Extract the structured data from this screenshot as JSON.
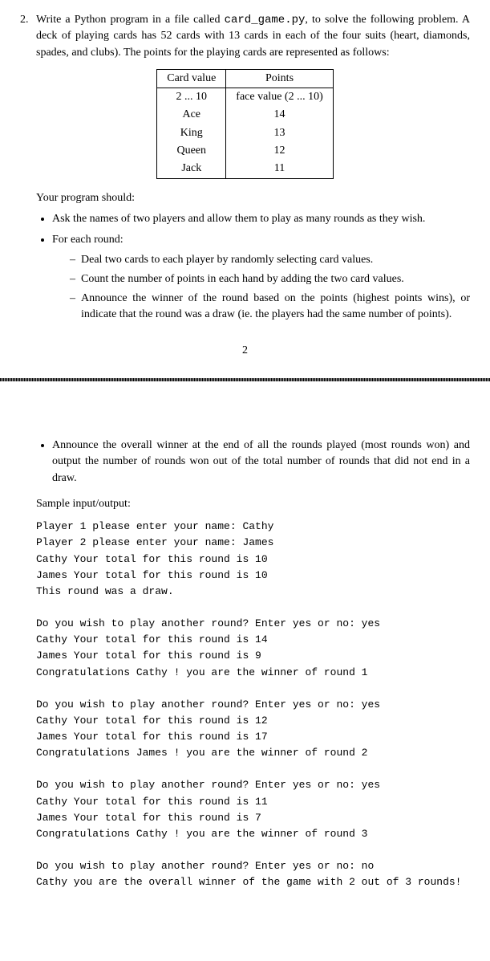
{
  "problem": {
    "number": "2.",
    "intro_pre": "Write a Python program in a file called ",
    "filename": "card_game.py",
    "intro_post": ", to solve the following problem. A deck of playing cards has 52 cards with 13 cards in each of the four suits (heart, diamonds, spades, and clubs). The points for the playing cards are represented as follows:"
  },
  "table": {
    "h1": "Card value",
    "h2": "Points",
    "rows": [
      {
        "v": "2 ... 10",
        "p": "face value (2 ... 10)"
      },
      {
        "v": "Ace",
        "p": "14"
      },
      {
        "v": "King",
        "p": "13"
      },
      {
        "v": "Queen",
        "p": "12"
      },
      {
        "v": "Jack",
        "p": "11"
      }
    ]
  },
  "req_intro": "Your program should:",
  "bullets": {
    "b1": "Ask the names of two players and allow them to play as many rounds as they wish.",
    "b2": "For each round:",
    "d1": "Deal two cards to each player by randomly selecting card values.",
    "d2": "Count the number of points in each hand by adding the two card values.",
    "d3": "Announce the winner of the round based on the points (highest points wins), or indicate that the round was a draw (ie. the players had the same number of points).",
    "b3": "Announce the overall winner at the end of all the rounds played (most rounds won) and output the number of rounds won out of the total number of rounds that did not end in a draw."
  },
  "page_number": "2",
  "sample_label": "Sample input/output:",
  "sample": "Player 1 please enter your name: Cathy\nPlayer 2 please enter your name: James\nCathy Your total for this round is 10\nJames Your total for this round is 10\nThis round was a draw.\n\nDo you wish to play another round? Enter yes or no: yes\nCathy Your total for this round is 14\nJames Your total for this round is 9\nCongratulations Cathy ! you are the winner of round 1\n\nDo you wish to play another round? Enter yes or no: yes\nCathy Your total for this round is 12\nJames Your total for this round is 17\nCongratulations James ! you are the winner of round 2\n\nDo you wish to play another round? Enter yes or no: yes\nCathy Your total for this round is 11\nJames Your total for this round is 7\nCongratulations Cathy ! you are the winner of round 3\n\nDo you wish to play another round? Enter yes or no: no\nCathy you are the overall winner of the game with 2 out of 3 rounds!"
}
